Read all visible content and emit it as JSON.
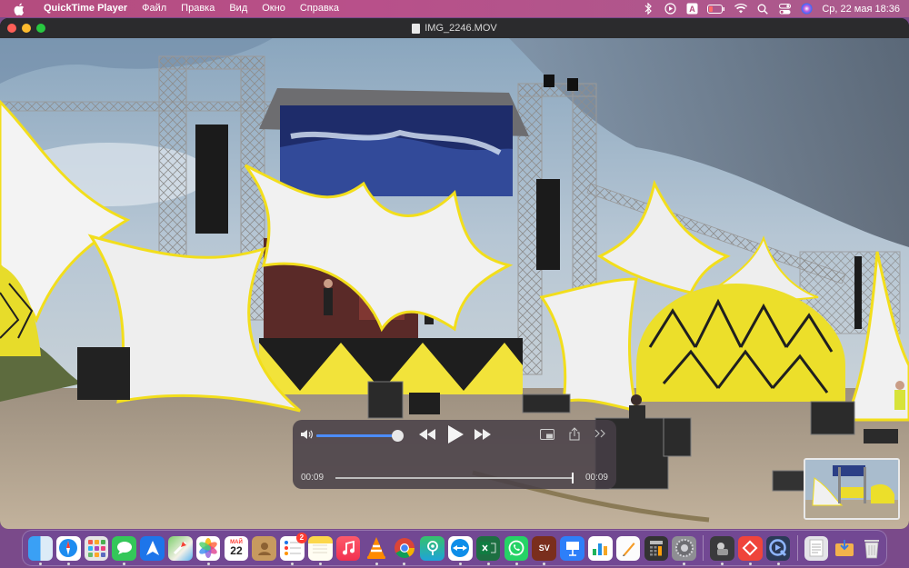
{
  "menubar": {
    "app_name": "QuickTime Player",
    "items": [
      "Файл",
      "Правка",
      "Вид",
      "Окно",
      "Справка"
    ],
    "clock": "Ср, 22 мая  18:36",
    "status_icons": [
      "bluetooth-icon",
      "play-circle-icon",
      "text-input-icon",
      "battery-icon",
      "wifi-icon",
      "search-icon",
      "control-center-icon",
      "siri-icon"
    ]
  },
  "window": {
    "title": "IMG_2246.MOV"
  },
  "player": {
    "current_time": "00:09",
    "remaining_time": "00:09",
    "volume": 0.93,
    "progress": 1.0
  },
  "dock": {
    "apps": [
      "finder",
      "safari",
      "launchpad",
      "messages",
      "maps-arrow",
      "maps",
      "photos",
      "calendar",
      "contacts",
      "reminders",
      "notes",
      "music",
      "vlc",
      "chrome",
      "find-my",
      "teamviewer",
      "excel",
      "whatsapp",
      "svg-app",
      "keynote",
      "numbers",
      "pages",
      "calculator",
      "system-settings"
    ],
    "calendar": {
      "month": "МАЙ",
      "day": "22"
    },
    "reminders_badge": "2",
    "sv_label": "SV"
  },
  "colors": {
    "menubar": "#b44c7e",
    "accent": "#4c8dff",
    "dock": "#70489a"
  }
}
